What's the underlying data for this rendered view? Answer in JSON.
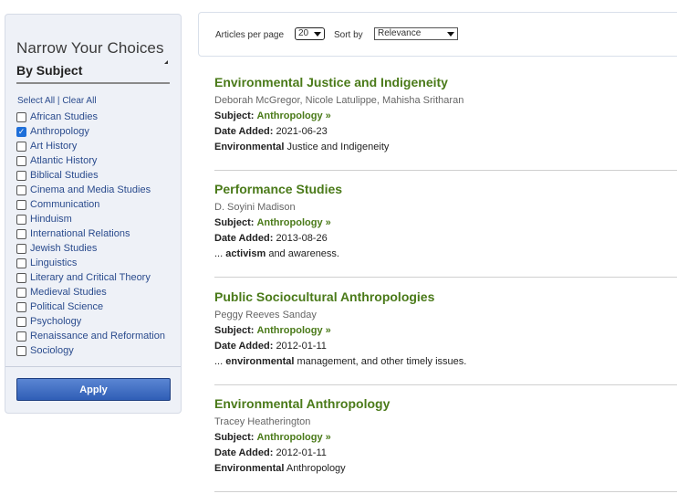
{
  "sidebar": {
    "title": "Narrow Your Choices",
    "section": "By Subject",
    "select_all": "Select All",
    "separator": "|",
    "clear_all": "Clear All",
    "subjects": [
      {
        "label": "African Studies",
        "checked": false
      },
      {
        "label": "Anthropology",
        "checked": true
      },
      {
        "label": "Art History",
        "checked": false
      },
      {
        "label": "Atlantic History",
        "checked": false
      },
      {
        "label": "Biblical Studies",
        "checked": false
      },
      {
        "label": "Cinema and Media Studies",
        "checked": false
      },
      {
        "label": "Communication",
        "checked": false
      },
      {
        "label": "Hinduism",
        "checked": false
      },
      {
        "label": "International Relations",
        "checked": false
      },
      {
        "label": "Jewish Studies",
        "checked": false
      },
      {
        "label": "Linguistics",
        "checked": false
      },
      {
        "label": "Literary and Critical Theory",
        "checked": false
      },
      {
        "label": "Medieval Studies",
        "checked": false
      },
      {
        "label": "Political Science",
        "checked": false
      },
      {
        "label": "Psychology",
        "checked": false
      },
      {
        "label": "Renaissance and Reformation",
        "checked": false
      },
      {
        "label": "Sociology",
        "checked": false
      }
    ],
    "apply_label": "Apply"
  },
  "toolbar": {
    "per_page_label": "Articles per page",
    "per_page_value": "20",
    "sort_label": "Sort by",
    "sort_value": "Relevance"
  },
  "results": [
    {
      "title": "Environmental Justice and Indigeneity",
      "authors": "Deborah McGregor, Nicole Latulippe, Mahisha Sritharan",
      "subject_label": "Subject:",
      "subject": "Anthropology »",
      "date_label": "Date Added:",
      "date": "2021-06-23",
      "snippet_bold": "Environmental",
      "snippet_rest": " Justice and Indigeneity",
      "snippet_prefix": ""
    },
    {
      "title": "Performance Studies",
      "authors": "D. Soyini Madison",
      "subject_label": "Subject:",
      "subject": "Anthropology »",
      "date_label": "Date Added:",
      "date": "2013-08-26",
      "snippet_prefix": "... ",
      "snippet_bold": "activism",
      "snippet_rest": " and awareness."
    },
    {
      "title": "Public Sociocultural Anthropologies",
      "authors": "Peggy Reeves Sanday",
      "subject_label": "Subject:",
      "subject": "Anthropology »",
      "date_label": "Date Added:",
      "date": "2012-01-11",
      "snippet_prefix": "... ",
      "snippet_bold": "environmental",
      "snippet_rest": " management, and other timely issues."
    },
    {
      "title": "Environmental Anthropology",
      "authors": "Tracey Heatherington",
      "subject_label": "Subject:",
      "subject": "Anthropology »",
      "date_label": "Date Added:",
      "date": "2012-01-11",
      "snippet_prefix": "",
      "snippet_bold": "Environmental",
      "snippet_rest": " Anthropology"
    }
  ]
}
